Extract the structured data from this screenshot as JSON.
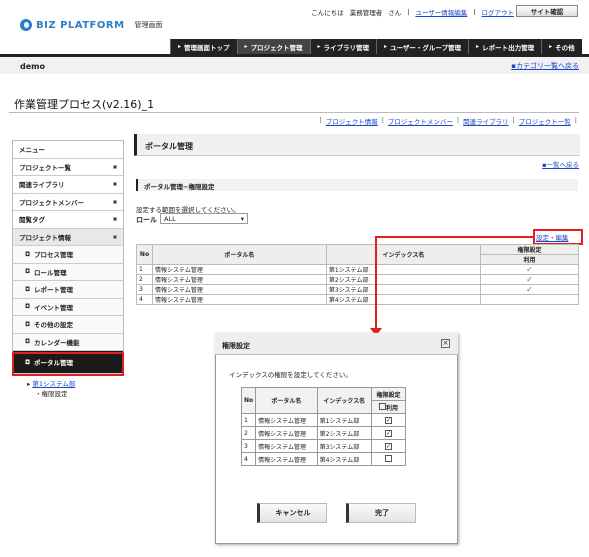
{
  "header": {
    "brand": "BIZ PLATFORM",
    "brand_sub": "管理画面",
    "greeting": "こんにちは",
    "user": "業務管理者",
    "honorific": "さん",
    "user_edit": "ユーザー情報編集",
    "logout": "ログアウト",
    "site_confirm": "サイト確認"
  },
  "nav": {
    "tabs": [
      "管理画面トップ",
      "プロジェクト管理",
      "ライブラリ管理",
      "ユーザー・グループ管理",
      "レポート出力管理",
      "その他"
    ],
    "active_index": 1
  },
  "subbar": {
    "site": "demo",
    "category_link": "カテゴリ一覧へ戻る"
  },
  "page": {
    "title": "作業管理プロセス(v2.16)_1",
    "links": [
      "プロジェクト情報",
      "プロジェクトメンバー",
      "関連ライブラリ",
      "プロジェクト一覧"
    ]
  },
  "sidebar": {
    "menu_header": "メニュー",
    "items": [
      "プロジェクト一覧",
      "関連ライブラリ",
      "プロジェクトメンバー",
      "閲覧タグ",
      "プロジェクト情報"
    ],
    "sub_items": [
      "プロセス管理",
      "ロール管理",
      "レポート管理",
      "イベント管理",
      "その他の設定",
      "カレンダー機能",
      "ポータル管理"
    ],
    "tree_parent": "第1システム部",
    "tree_child": "権限設定"
  },
  "main": {
    "title": "ポータル管理",
    "back_link": "一覧へ戻る",
    "section_title": "ポータル管理−権限設定",
    "instruction": "設定する範囲を選択してください。",
    "role_label": "ロール",
    "role_value": "ALL",
    "setting_link": "設定・編集",
    "table": {
      "headers": {
        "no": "No",
        "portal": "ポータル名",
        "index": "インデックス名",
        "perm": "権限設定",
        "use": "利用"
      },
      "rows": [
        {
          "no": "1",
          "portal": "情報システム管理",
          "index": "第1システム部",
          "use": "✓"
        },
        {
          "no": "2",
          "portal": "情報システム管理",
          "index": "第2システム部",
          "use": "✓"
        },
        {
          "no": "3",
          "portal": "情報システム管理",
          "index": "第3システム部",
          "use": "✓"
        },
        {
          "no": "4",
          "portal": "情報システム管理",
          "index": "第4システム部",
          "use": ""
        }
      ]
    }
  },
  "dialog": {
    "title": "権限設定",
    "close": "×",
    "message": "インデックスの権限を設定してください。",
    "headers": {
      "no": "No",
      "portal": "ポータル名",
      "index": "インデックス名",
      "perm": "権限設定",
      "use": "利用"
    },
    "rows": [
      {
        "no": "1",
        "portal": "情報システム管理",
        "index": "第1システム部",
        "checked": "✓"
      },
      {
        "no": "2",
        "portal": "情報システム管理",
        "index": "第2システム部",
        "checked": "✓"
      },
      {
        "no": "3",
        "portal": "情報システム管理",
        "index": "第3システム部",
        "checked": "✓"
      },
      {
        "no": "4",
        "portal": "情報システム管理",
        "index": "第4システム部",
        "checked": ""
      }
    ],
    "cancel": "キャンセル",
    "done": "完了"
  },
  "colors": {
    "accent": "#2a7fc9",
    "highlight": "#e02020",
    "nav_bg": "#222222"
  }
}
